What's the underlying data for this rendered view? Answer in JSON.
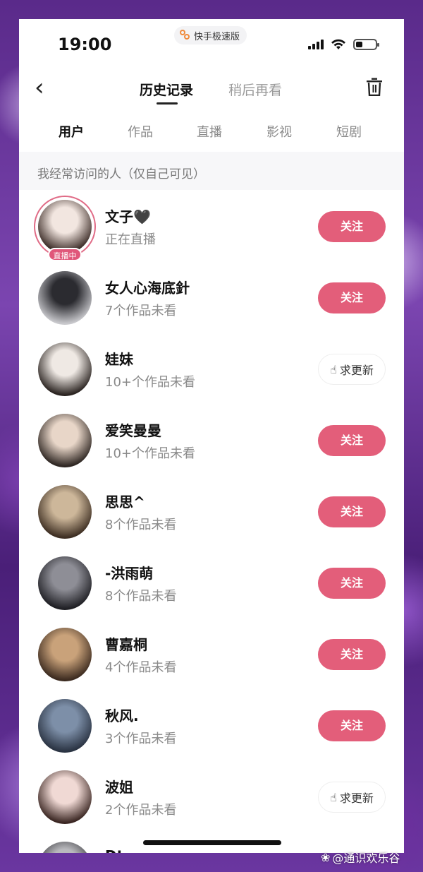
{
  "status_bar": {
    "time": "19:00",
    "app_badge": "快手极速版"
  },
  "header": {
    "tab_history": "历史记录",
    "tab_later": "稍后再看"
  },
  "sub_tabs": [
    "用户",
    "作品",
    "直播",
    "影视",
    "短剧"
  ],
  "section_title": "我经常访问的人（仅自己可见）",
  "buttons": {
    "follow": "关注",
    "request": "求更新"
  },
  "live_badge": "直播中",
  "users": [
    {
      "name": "文子🖤",
      "sub": "正在直播",
      "action": "follow",
      "live": true
    },
    {
      "name": "女人心海底針",
      "sub": "7个作品未看",
      "action": "follow",
      "live": false
    },
    {
      "name": "娃妹",
      "sub": "10+个作品未看",
      "action": "request",
      "live": false
    },
    {
      "name": "爱笑曼曼",
      "sub": "10+个作品未看",
      "action": "follow",
      "live": false
    },
    {
      "name": "思思^",
      "sub": "8个作品未看",
      "action": "follow",
      "live": false
    },
    {
      "name": "-洪雨萌",
      "sub": "8个作品未看",
      "action": "follow",
      "live": false
    },
    {
      "name": "曹嘉桐",
      "sub": "4个作品未看",
      "action": "follow",
      "live": false
    },
    {
      "name": "秋风.",
      "sub": "3个作品未看",
      "action": "follow",
      "live": false
    },
    {
      "name": "波姐",
      "sub": "2个作品未看",
      "action": "request",
      "live": false
    },
    {
      "name": "Dt",
      "sub": "",
      "action": "follow",
      "live": false
    }
  ],
  "watermark": "@通识欢乐谷",
  "colors": {
    "accent": "#e35e7a",
    "live_ring": "#e06b86"
  }
}
